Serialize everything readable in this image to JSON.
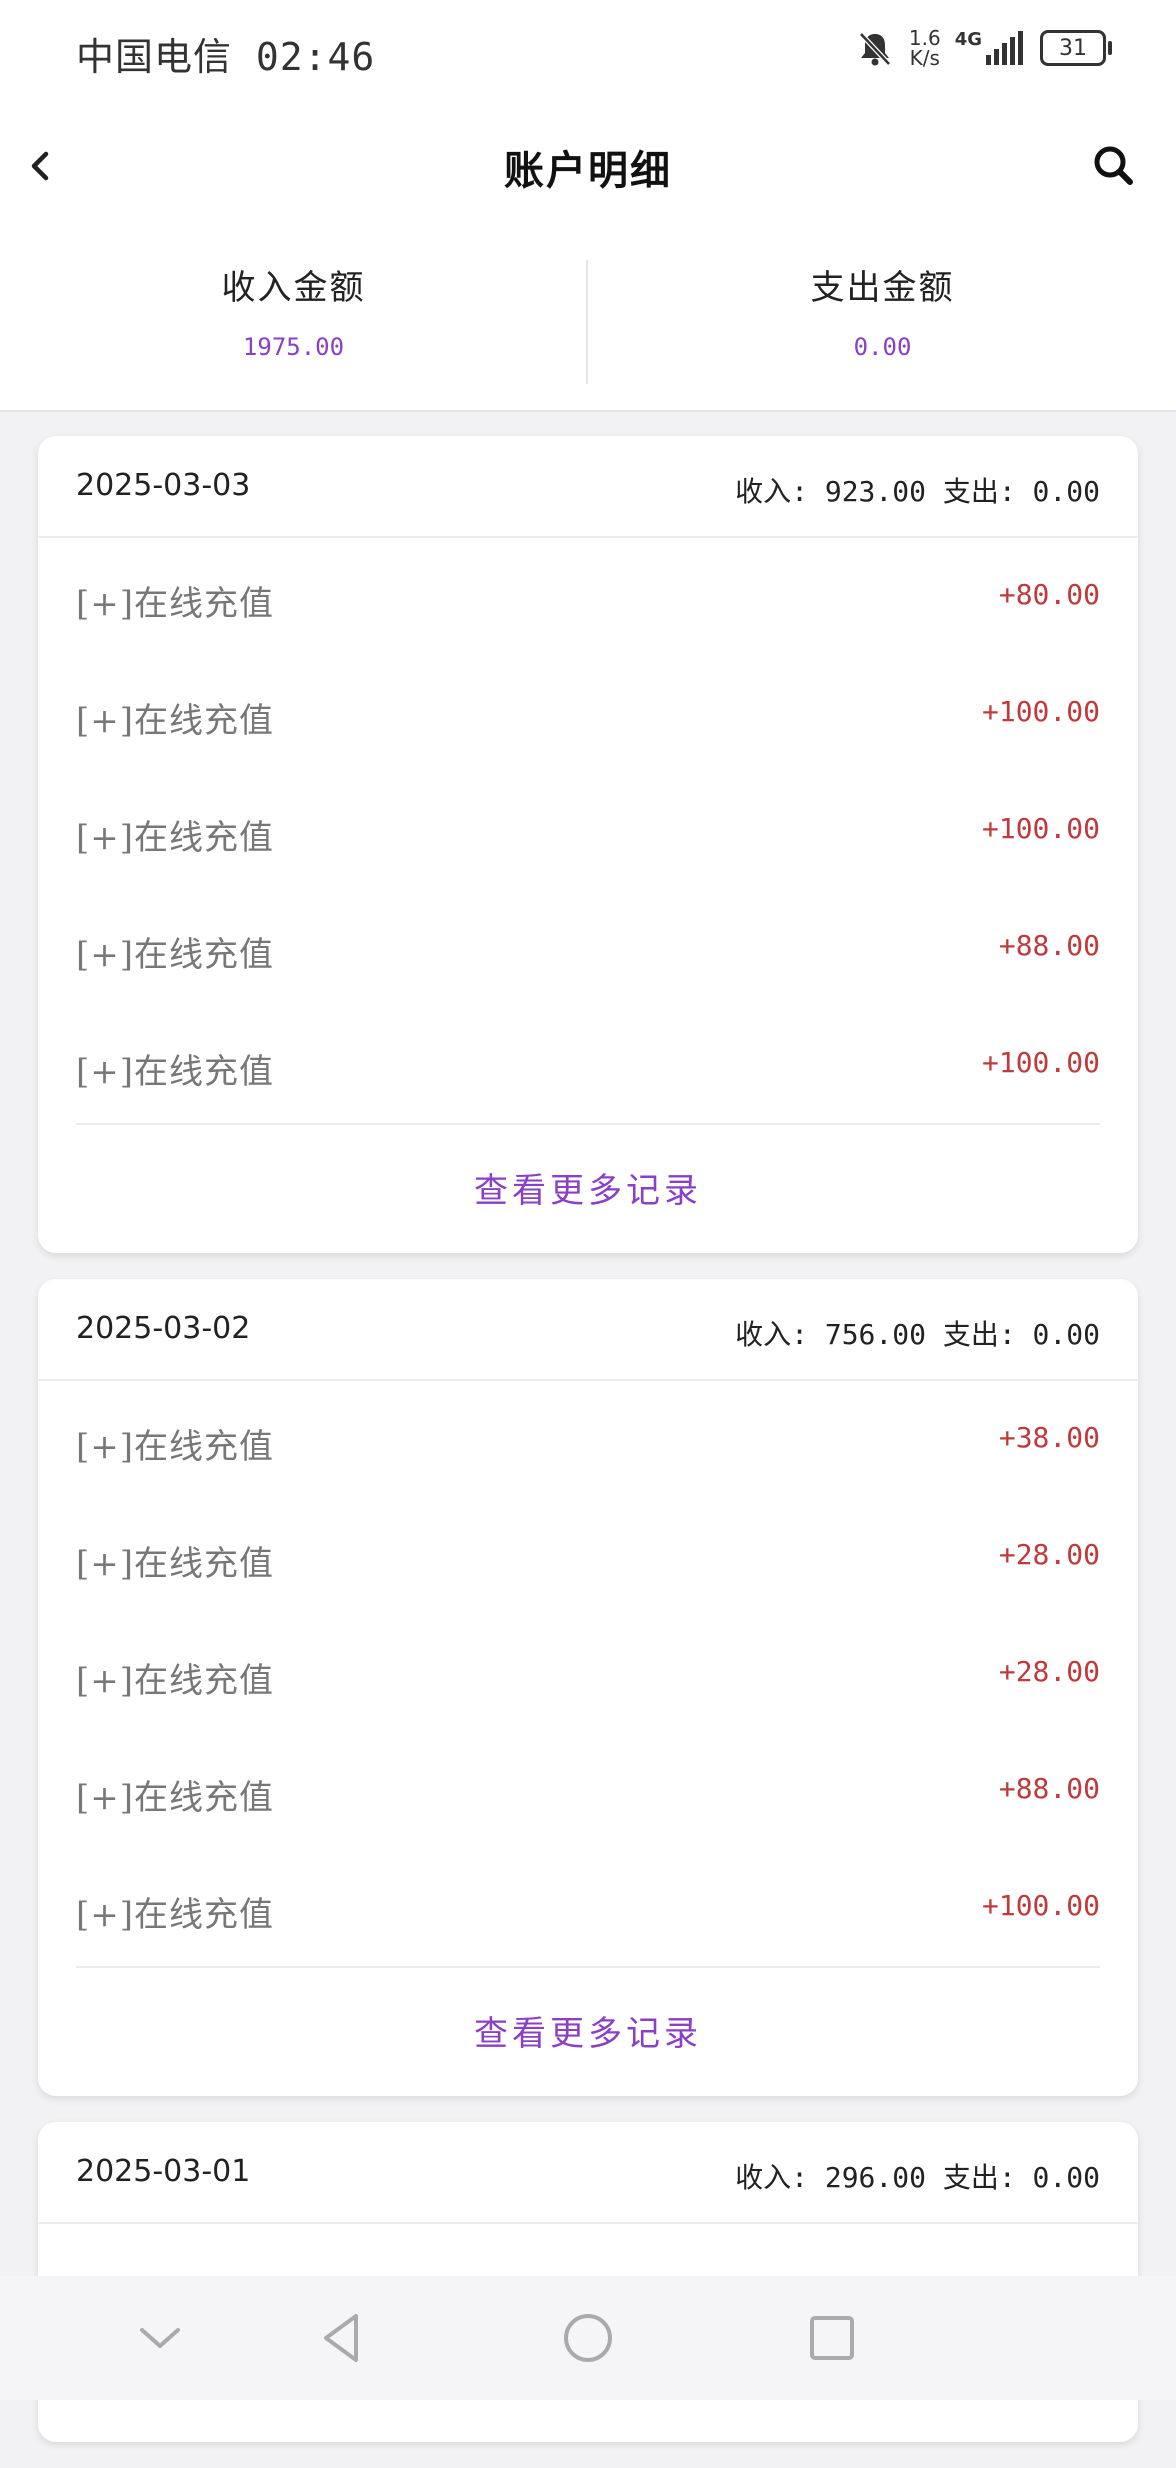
{
  "status_bar": {
    "carrier_time": "中国电信 02:46",
    "speed_value": "1.6",
    "speed_unit": "K/s",
    "network": "4G",
    "battery": "31",
    "icons": [
      "bell-muted-icon",
      "signal-icon",
      "battery-icon"
    ]
  },
  "header": {
    "title": "账户明细",
    "back_icon": "chevron-left-icon",
    "search_icon": "search-icon"
  },
  "summary": {
    "income_label": "收入金额",
    "income_value": "1975.00",
    "expense_label": "支出金额",
    "expense_value": "0.00"
  },
  "colors": {
    "accent": "#8a3fc7",
    "amount": "#c0393b",
    "background": "#f2f2f4"
  },
  "days": [
    {
      "date": "2025-03-03",
      "totals": "收入: 923.00 支出: 0.00",
      "rows": [
        {
          "label": "[+]在线充值",
          "amount": "+80.00"
        },
        {
          "label": "[+]在线充值",
          "amount": "+100.00"
        },
        {
          "label": "[+]在线充值",
          "amount": "+100.00"
        },
        {
          "label": "[+]在线充值",
          "amount": "+88.00"
        },
        {
          "label": "[+]在线充值",
          "amount": "+100.00"
        }
      ],
      "more": "查看更多记录"
    },
    {
      "date": "2025-03-02",
      "totals": "收入: 756.00 支出: 0.00",
      "rows": [
        {
          "label": "[+]在线充值",
          "amount": "+38.00"
        },
        {
          "label": "[+]在线充值",
          "amount": "+28.00"
        },
        {
          "label": "[+]在线充值",
          "amount": "+28.00"
        },
        {
          "label": "[+]在线充值",
          "amount": "+88.00"
        },
        {
          "label": "[+]在线充值",
          "amount": "+100.00"
        }
      ],
      "more": "查看更多记录"
    },
    {
      "date": "2025-03-01",
      "totals": "收入: 296.00 支出: 0.00"
    }
  ],
  "nav_icons": [
    "chevron-down-icon",
    "back-triangle-icon",
    "home-circle-icon",
    "recents-square-icon"
  ]
}
